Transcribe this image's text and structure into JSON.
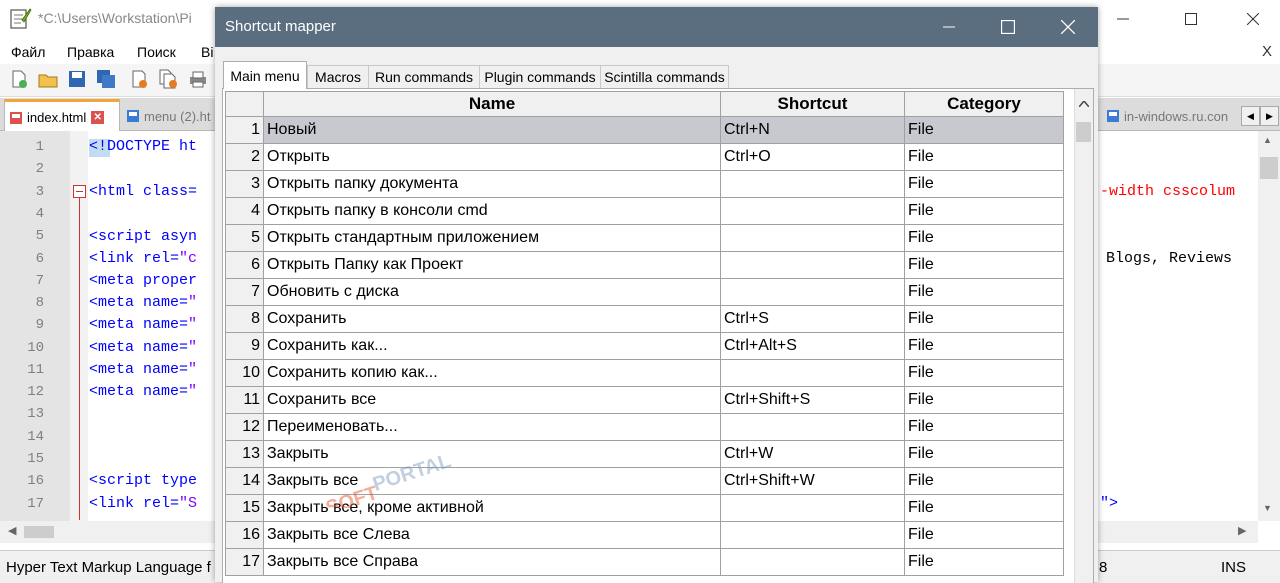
{
  "npp": {
    "title": "*C:\\Users\\Workstation\\Pi",
    "menu": [
      "Файл",
      "Правка",
      "Поиск",
      "Вi"
    ],
    "menu_close": "X",
    "tabs": {
      "active": "index.html",
      "second": "menu (2).ht",
      "right": "in-windows.ru.con"
    },
    "line_numbers": [
      "1",
      "2",
      "3",
      "4",
      "5",
      "6",
      "7",
      "8",
      "9",
      "10",
      "11",
      "12",
      "13",
      "14",
      "15",
      "16",
      "17"
    ],
    "code": {
      "l1": "<!DOCTYPE ht",
      "l3": "<html class=",
      "l3_right": "-width csscolum",
      "l5": "<script asyn",
      "l6a": "<link rel=",
      "l6b": "\"c",
      "l6_right": ", Blogs, Reviews",
      "l7": "<meta proper",
      "l8a": "<meta name=",
      "l8b": "\"",
      "l9a": "<meta name=",
      "l9b": "\"",
      "l10a": "<meta name=",
      "l10b": "\"",
      "l11a": "<meta name=",
      "l11b": "\"",
      "l12a": "<meta name=",
      "l12b": "\"",
      "l16": "<script type",
      "l17a": "<link rel=",
      "l17b": "\"S",
      "l17_right": "\">"
    },
    "status": {
      "language": "Hyper Text Markup Language f",
      "col": "8",
      "mode": "INS"
    }
  },
  "dialog": {
    "title": "Shortcut mapper",
    "tabs": [
      "Main menu",
      "Macros",
      "Run commands",
      "Plugin commands",
      "Scintilla commands"
    ],
    "columns": [
      "Name",
      "Shortcut",
      "Category"
    ],
    "rows": [
      {
        "n": "1",
        "name": "Новый",
        "shortcut": "Ctrl+N",
        "category": "File"
      },
      {
        "n": "2",
        "name": "Открыть",
        "shortcut": "Ctrl+O",
        "category": "File"
      },
      {
        "n": "3",
        "name": "Открыть папку документа",
        "shortcut": "",
        "category": "File"
      },
      {
        "n": "4",
        "name": "Открыть папку в консоли cmd",
        "shortcut": "",
        "category": "File"
      },
      {
        "n": "5",
        "name": "Открыть стандартным приложением",
        "shortcut": "",
        "category": "File"
      },
      {
        "n": "6",
        "name": "Открыть Папку как Проект",
        "shortcut": "",
        "category": "File"
      },
      {
        "n": "7",
        "name": "Обновить с диска",
        "shortcut": "",
        "category": "File"
      },
      {
        "n": "8",
        "name": "Сохранить",
        "shortcut": "Ctrl+S",
        "category": "File"
      },
      {
        "n": "9",
        "name": "Сохранить как...",
        "shortcut": "Ctrl+Alt+S",
        "category": "File"
      },
      {
        "n": "10",
        "name": "Сохранить копию как...",
        "shortcut": "",
        "category": "File"
      },
      {
        "n": "11",
        "name": "Сохранить все",
        "shortcut": "Ctrl+Shift+S",
        "category": "File"
      },
      {
        "n": "12",
        "name": "Переименовать...",
        "shortcut": "",
        "category": "File"
      },
      {
        "n": "13",
        "name": "Закрыть",
        "shortcut": "Ctrl+W",
        "category": "File"
      },
      {
        "n": "14",
        "name": "Закрыть все",
        "shortcut": "Ctrl+Shift+W",
        "category": "File"
      },
      {
        "n": "15",
        "name": "Закрыть все, кроме активной",
        "shortcut": "",
        "category": "File"
      },
      {
        "n": "16",
        "name": "Закрыть все Слева",
        "shortcut": "",
        "category": "File"
      },
      {
        "n": "17",
        "name": "Закрыть все Справа",
        "shortcut": "",
        "category": "File"
      }
    ],
    "selected_row": 1
  },
  "watermark": {
    "text_a": "SOFT",
    "text_b": "PORTAL"
  },
  "colors": {
    "dialog_titlebar": "#5a6e7f",
    "selected_row": "#c8c8d0",
    "tab_accent": "#f3a53b"
  }
}
